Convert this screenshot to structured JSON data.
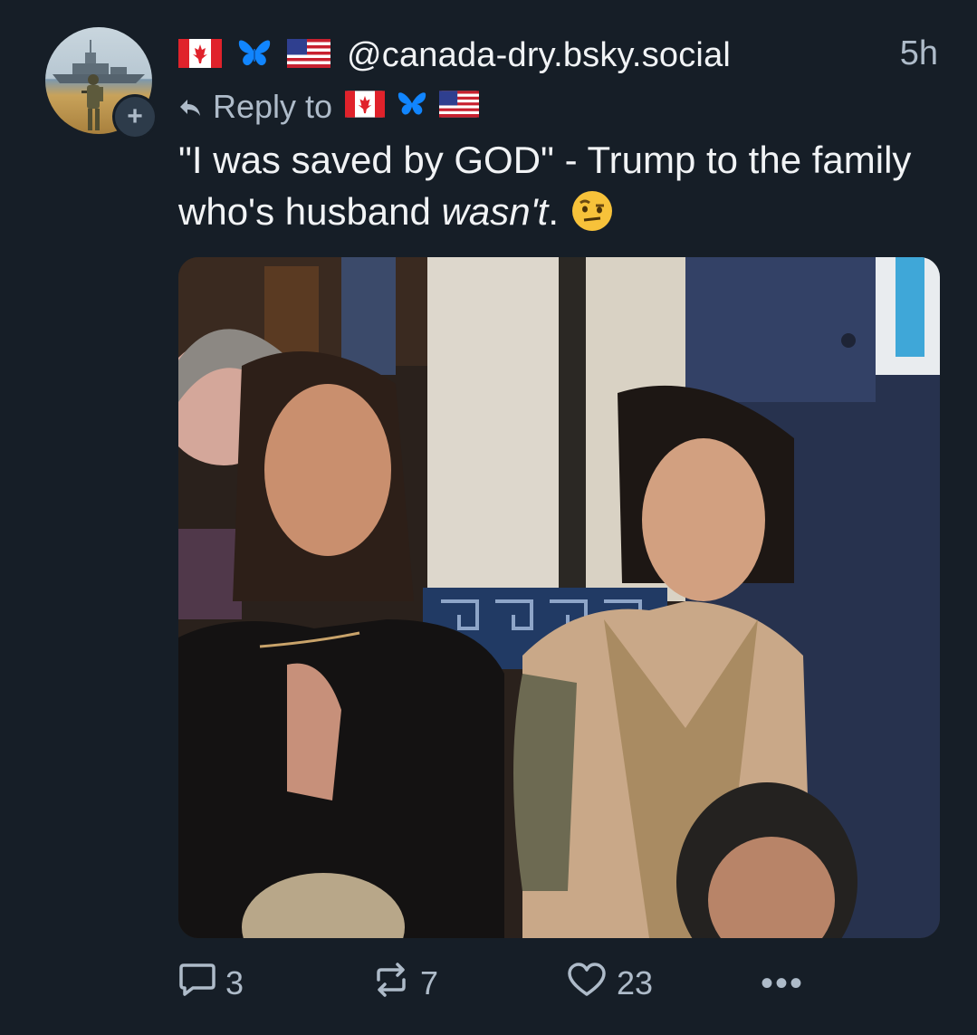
{
  "post": {
    "handle": "@canada-dry.bsky.social",
    "timestamp": "5h",
    "reply_prefix": "Reply to",
    "text_part1": "\"I was saved by GOD\" - Trump to the family who's husband ",
    "text_italic": "wasn't",
    "text_part2": ".",
    "author_flags": [
      "canada-flag",
      "butterfly",
      "us-flag"
    ],
    "reply_flags": [
      "canada-flag",
      "butterfly",
      "us-flag"
    ],
    "emoji": "face-with-raised-eyebrow"
  },
  "actions": {
    "reply_count": "3",
    "repost_count": "7",
    "like_count": "23",
    "more_label": "•••"
  },
  "colors": {
    "background": "#161e27",
    "text_primary": "#f1f3f5",
    "text_secondary": "#aebbc9",
    "bluesky_blue": "#1185fe"
  }
}
